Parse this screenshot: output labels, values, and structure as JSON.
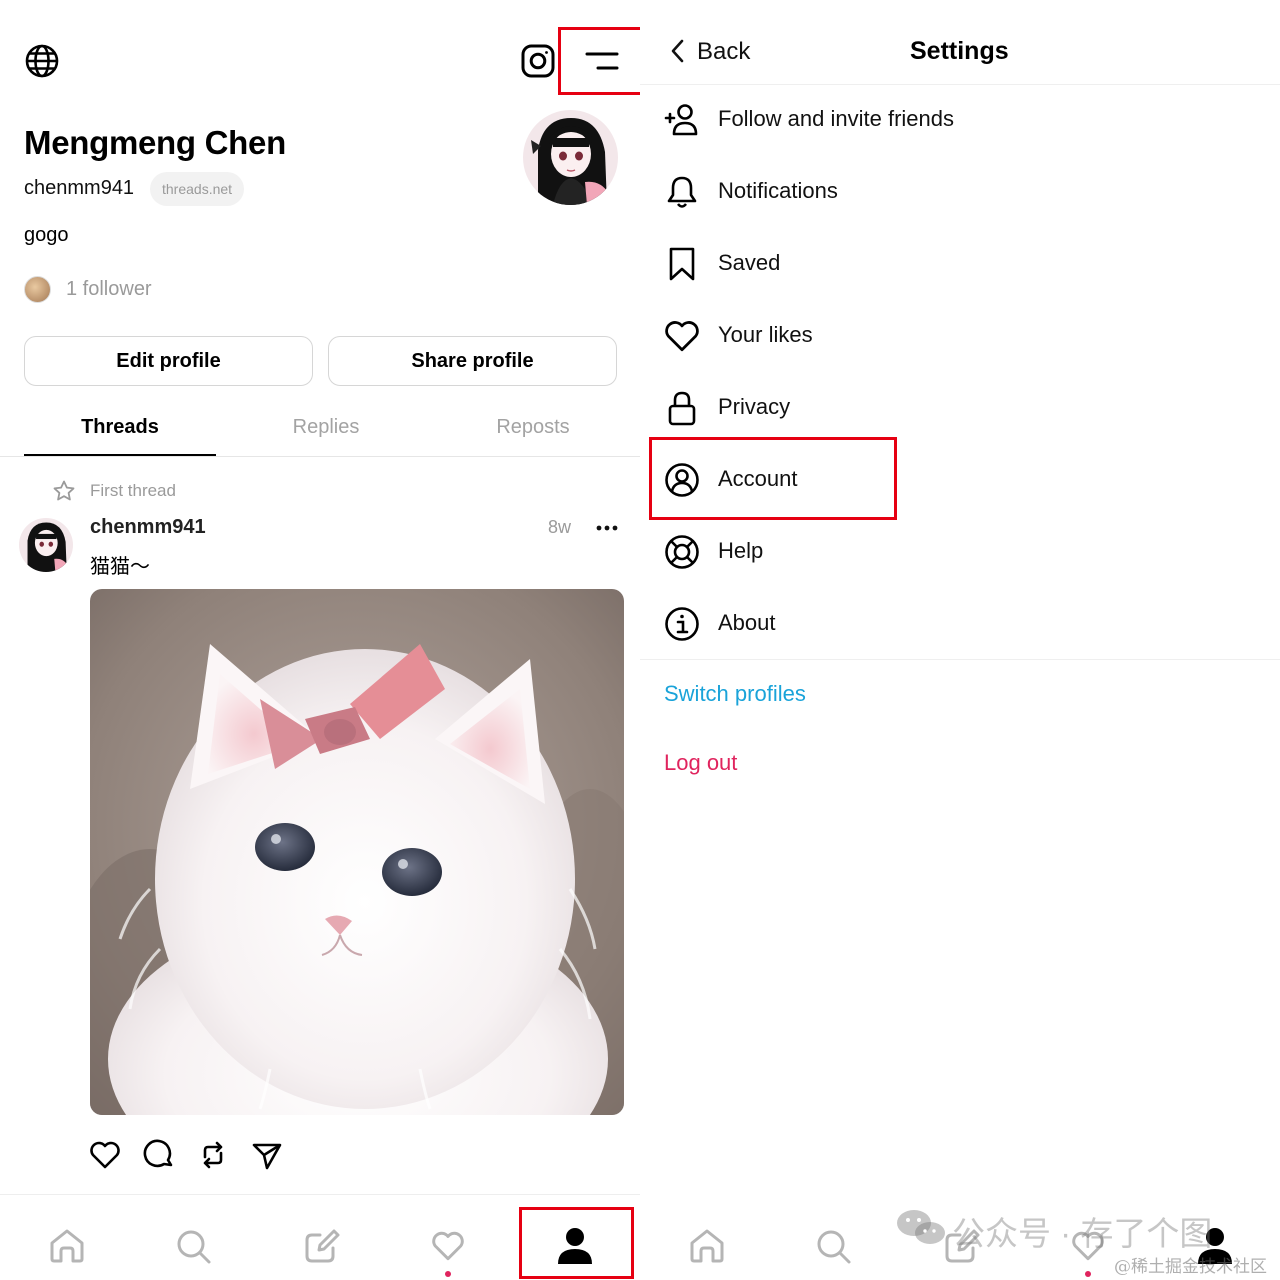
{
  "profile": {
    "name": "Mengmeng Chen",
    "handle": "chenmm941",
    "domain": "threads.net",
    "bio": "gogo",
    "followers": "1 follower",
    "edit_profile": "Edit profile",
    "share_profile": "Share profile",
    "tabs": [
      {
        "label": "Threads",
        "active": true
      },
      {
        "label": "Replies",
        "active": false
      },
      {
        "label": "Reposts",
        "active": false
      }
    ]
  },
  "post": {
    "pinned_label": "First thread",
    "author": "chenmm941",
    "time": "8w",
    "text": "猫猫～",
    "actions": [
      "like",
      "comment",
      "repost",
      "share"
    ]
  },
  "bottom_nav": {
    "items": [
      "home",
      "search",
      "compose",
      "activity",
      "profile"
    ],
    "active": "profile"
  },
  "settings": {
    "back_label": "Back",
    "title": "Settings",
    "items": [
      {
        "label": "Follow and invite friends",
        "icon": "add-person-icon"
      },
      {
        "label": "Notifications",
        "icon": "bell-icon"
      },
      {
        "label": "Saved",
        "icon": "bookmark-icon"
      },
      {
        "label": "Your likes",
        "icon": "heart-icon"
      },
      {
        "label": "Privacy",
        "icon": "lock-icon"
      },
      {
        "label": "Account",
        "icon": "account-circle-icon"
      },
      {
        "label": "Help",
        "icon": "lifebuoy-icon"
      },
      {
        "label": "About",
        "icon": "info-icon"
      }
    ],
    "switch_profiles": "Switch profiles",
    "log_out": "Log out"
  },
  "watermark": {
    "main": "公众号 · 存了个图",
    "sub": "@稀土掘金技术社区"
  },
  "colors": {
    "highlight": "#e60012",
    "switch_profiles": "#1aa3d9",
    "log_out": "#e0245e",
    "notification_dot": "#e0245e",
    "muted_text": "#9a9a9a"
  }
}
